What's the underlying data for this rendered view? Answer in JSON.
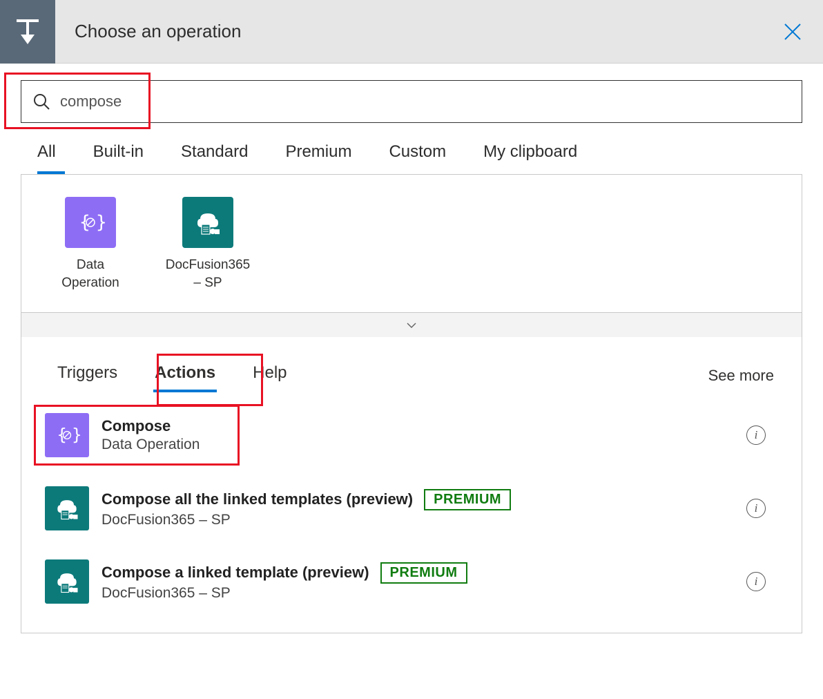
{
  "header": {
    "title": "Choose an operation"
  },
  "search": {
    "value": "compose"
  },
  "filterTabs": [
    {
      "label": "All",
      "active": true
    },
    {
      "label": "Built-in",
      "active": false
    },
    {
      "label": "Standard",
      "active": false
    },
    {
      "label": "Premium",
      "active": false
    },
    {
      "label": "Custom",
      "active": false
    },
    {
      "label": "My clipboard",
      "active": false
    }
  ],
  "connectors": [
    {
      "label": "Data Operation",
      "iconType": "purple"
    },
    {
      "label": "DocFusion365 – SP",
      "iconType": "teal"
    }
  ],
  "subTabs": [
    {
      "label": "Triggers",
      "active": false
    },
    {
      "label": "Actions",
      "active": true
    },
    {
      "label": "Help",
      "active": false
    }
  ],
  "seeMore": "See more",
  "actions": [
    {
      "title": "Compose",
      "subtitle": "Data Operation",
      "iconType": "purple",
      "premium": false,
      "highlighted": true
    },
    {
      "title": "Compose all the linked templates (preview)",
      "subtitle": "DocFusion365 – SP",
      "iconType": "teal",
      "premium": true,
      "highlighted": false
    },
    {
      "title": "Compose a linked template (preview)",
      "subtitle": "DocFusion365 – SP",
      "iconType": "teal",
      "premium": true,
      "highlighted": false
    }
  ],
  "premiumLabel": "PREMIUM"
}
